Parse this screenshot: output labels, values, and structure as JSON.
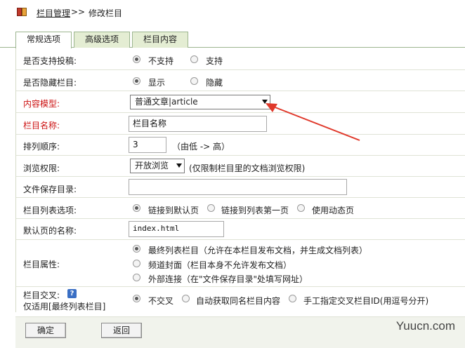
{
  "breadcrumb": {
    "link": "栏目管理",
    "separator": ">>",
    "current": "修改栏目"
  },
  "tabs": [
    {
      "label": "常规选项",
      "active": true
    },
    {
      "label": "高级选项",
      "active": false
    },
    {
      "label": "栏目内容",
      "active": false
    }
  ],
  "form": {
    "support_submit": {
      "label": "是否支持投稿:",
      "options": [
        "不支持",
        "支持"
      ],
      "selected": "不支持"
    },
    "hide_category": {
      "label": "是否隐藏栏目:",
      "options": [
        "显示",
        "隐藏"
      ],
      "selected": "显示"
    },
    "content_model": {
      "label": "内容模型:",
      "value": "普通文章|article"
    },
    "category_name": {
      "label": "栏目名称:",
      "value": "栏目名称"
    },
    "sort_order": {
      "label": "排列顺序:",
      "value": "3",
      "hint": "（由低 -> 高）"
    },
    "browse_permission": {
      "label": "浏览权限:",
      "value": "开放浏览",
      "hint": "(仅限制栏目里的文档浏览权限)"
    },
    "save_dir": {
      "label": "文件保存目录:",
      "value": ""
    },
    "list_option": {
      "label": "栏目列表选项:",
      "options": [
        "链接到默认页",
        "链接到列表第一页",
        "使用动态页"
      ],
      "selected": "链接到默认页"
    },
    "default_page": {
      "label": "默认页的名称:",
      "value": "index.html"
    },
    "category_attr": {
      "label": "栏目属性:",
      "options": [
        "最终列表栏目（允许在本栏目发布文档，并生成文档列表）",
        "频道封面（栏目本身不允许发布文档）",
        "外部连接（在\"文件保存目录\"处填写网址）"
      ],
      "selected": "最终列表栏目（允许在本栏目发布文档，并生成文档列表）"
    },
    "cross": {
      "label": "栏目交叉:",
      "sublabel": "仅适用[最终列表栏目]",
      "help": "?",
      "options": [
        "不交叉",
        "自动获取同名栏目内容",
        "手工指定交叉栏目ID(用逗号分开)"
      ],
      "selected": "不交叉"
    }
  },
  "buttons": {
    "ok": "确定",
    "back": "返回"
  },
  "watermark": "Yuucn.com",
  "colors": {
    "required_label": "#cc1111",
    "tab_border": "#9cb58f",
    "tab_inactive_bg": "#e4edd3",
    "annotation_arrow": "#e0392b"
  }
}
